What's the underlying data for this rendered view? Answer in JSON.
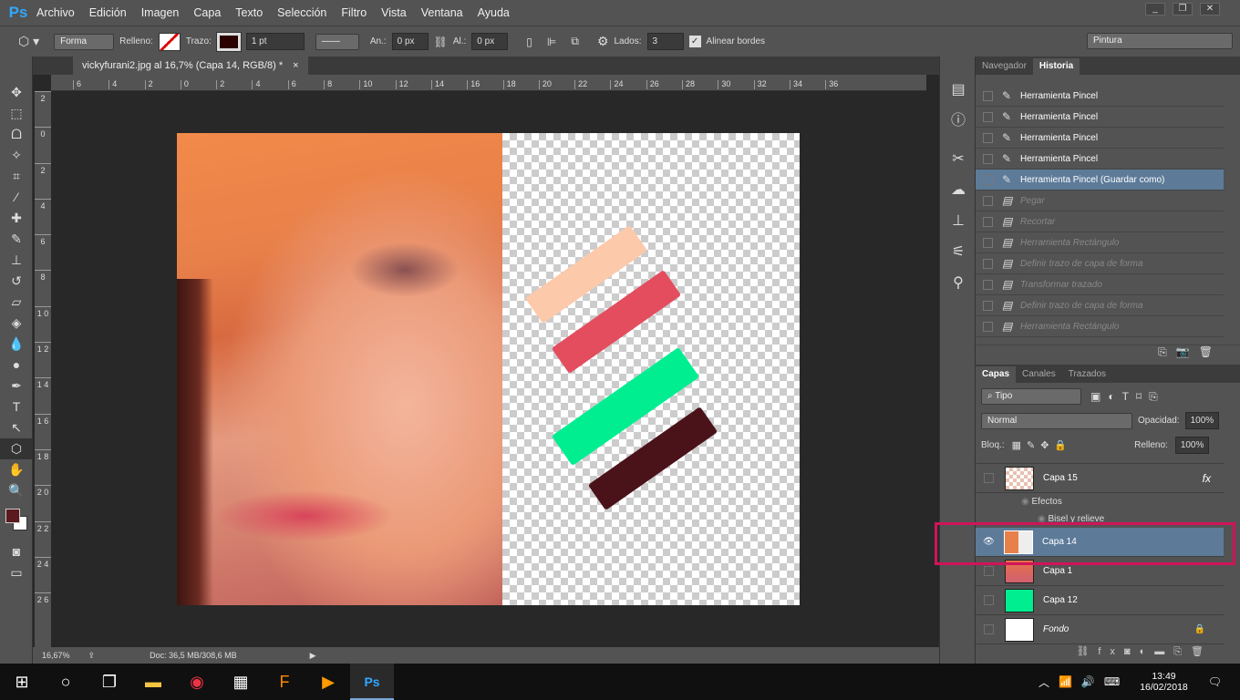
{
  "app": {
    "logo": "Ps",
    "menu": [
      "Archivo",
      "Edición",
      "Imagen",
      "Capa",
      "Texto",
      "Selección",
      "Filtro",
      "Vista",
      "Ventana",
      "Ayuda"
    ]
  },
  "options": {
    "mode": "Forma",
    "fill_label": "Relleno:",
    "stroke_label": "Trazo:",
    "stroke_width": "1 pt",
    "width_label": "An.:",
    "width_value": "0 px",
    "height_label": "Al.:",
    "height_value": "0 px",
    "sides_label": "Lados:",
    "sides_value": "3",
    "align_edges": "Alinear bordes",
    "workspace": "Pintura"
  },
  "document": {
    "tab": "vickyfurani2.jpg al 16,7% (Capa 14, RGB/8) *",
    "close": "×",
    "ruler_top": [
      "6",
      "4",
      "2",
      "0",
      "2",
      "4",
      "6",
      "8",
      "10",
      "12",
      "14",
      "16",
      "18",
      "20",
      "22",
      "24",
      "26",
      "28",
      "30",
      "32",
      "34",
      "36"
    ],
    "ruler_left": [
      "2",
      "0",
      "2",
      "4",
      "6",
      "8",
      "1 0",
      "1 2",
      "1 4",
      "1 6",
      "1 8",
      "2 0",
      "2 2",
      "2 4",
      "2 6"
    ]
  },
  "strokes": [
    {
      "color": "#fcc9ab"
    },
    {
      "color": "#e34d5e"
    },
    {
      "color": "#00ee90"
    },
    {
      "color": "#4a1219"
    }
  ],
  "status": {
    "zoom": "16,67%",
    "doc": "Doc: 36,5 MB/308,6 MB"
  },
  "history": {
    "tabs": [
      "Navegador",
      "Historia"
    ],
    "items": [
      {
        "label": "Herramienta Pincel",
        "state": "active"
      },
      {
        "label": "Herramienta Pincel",
        "state": "active"
      },
      {
        "label": "Herramienta Pincel",
        "state": "active"
      },
      {
        "label": "Herramienta Pincel",
        "state": "active"
      },
      {
        "label": "Herramienta Pincel (Guardar como)",
        "state": "current"
      },
      {
        "label": "Pegar",
        "state": "undone"
      },
      {
        "label": "Recortar",
        "state": "undone"
      },
      {
        "label": "Herramienta Rectángulo",
        "state": "undone"
      },
      {
        "label": "Definir trazo de capa de forma",
        "state": "undone"
      },
      {
        "label": "Transformar trazado",
        "state": "undone"
      },
      {
        "label": "Definir trazo de capa de forma",
        "state": "undone"
      },
      {
        "label": "Herramienta Rectángulo",
        "state": "undone"
      }
    ]
  },
  "layers": {
    "tabs": [
      "Capas",
      "Canales",
      "Trazados"
    ],
    "filter": "Tipo",
    "blend": "Normal",
    "opacity_label": "Opacidad:",
    "opacity": "100%",
    "lock_label": "Bloq.:",
    "fill_label": "Relleno:",
    "fill": "100%",
    "items": [
      {
        "name": "Capa 15",
        "fx": "fx",
        "visible": false
      },
      {
        "name": "Capa 14",
        "visible": true,
        "selected": true
      },
      {
        "name": "Capa 1",
        "visible": false
      },
      {
        "name": "Capa 12",
        "visible": false
      },
      {
        "name": "Fondo",
        "visible": false,
        "locked": true
      }
    ],
    "effects": "Efectos",
    "bevel": "Bisel y relieve"
  },
  "colors": {
    "highlight": "#d0145a",
    "foreground": "#5a1a1e",
    "background": "#ffffff"
  },
  "taskbar": {
    "time": "13:49",
    "date": "16/02/2018"
  }
}
